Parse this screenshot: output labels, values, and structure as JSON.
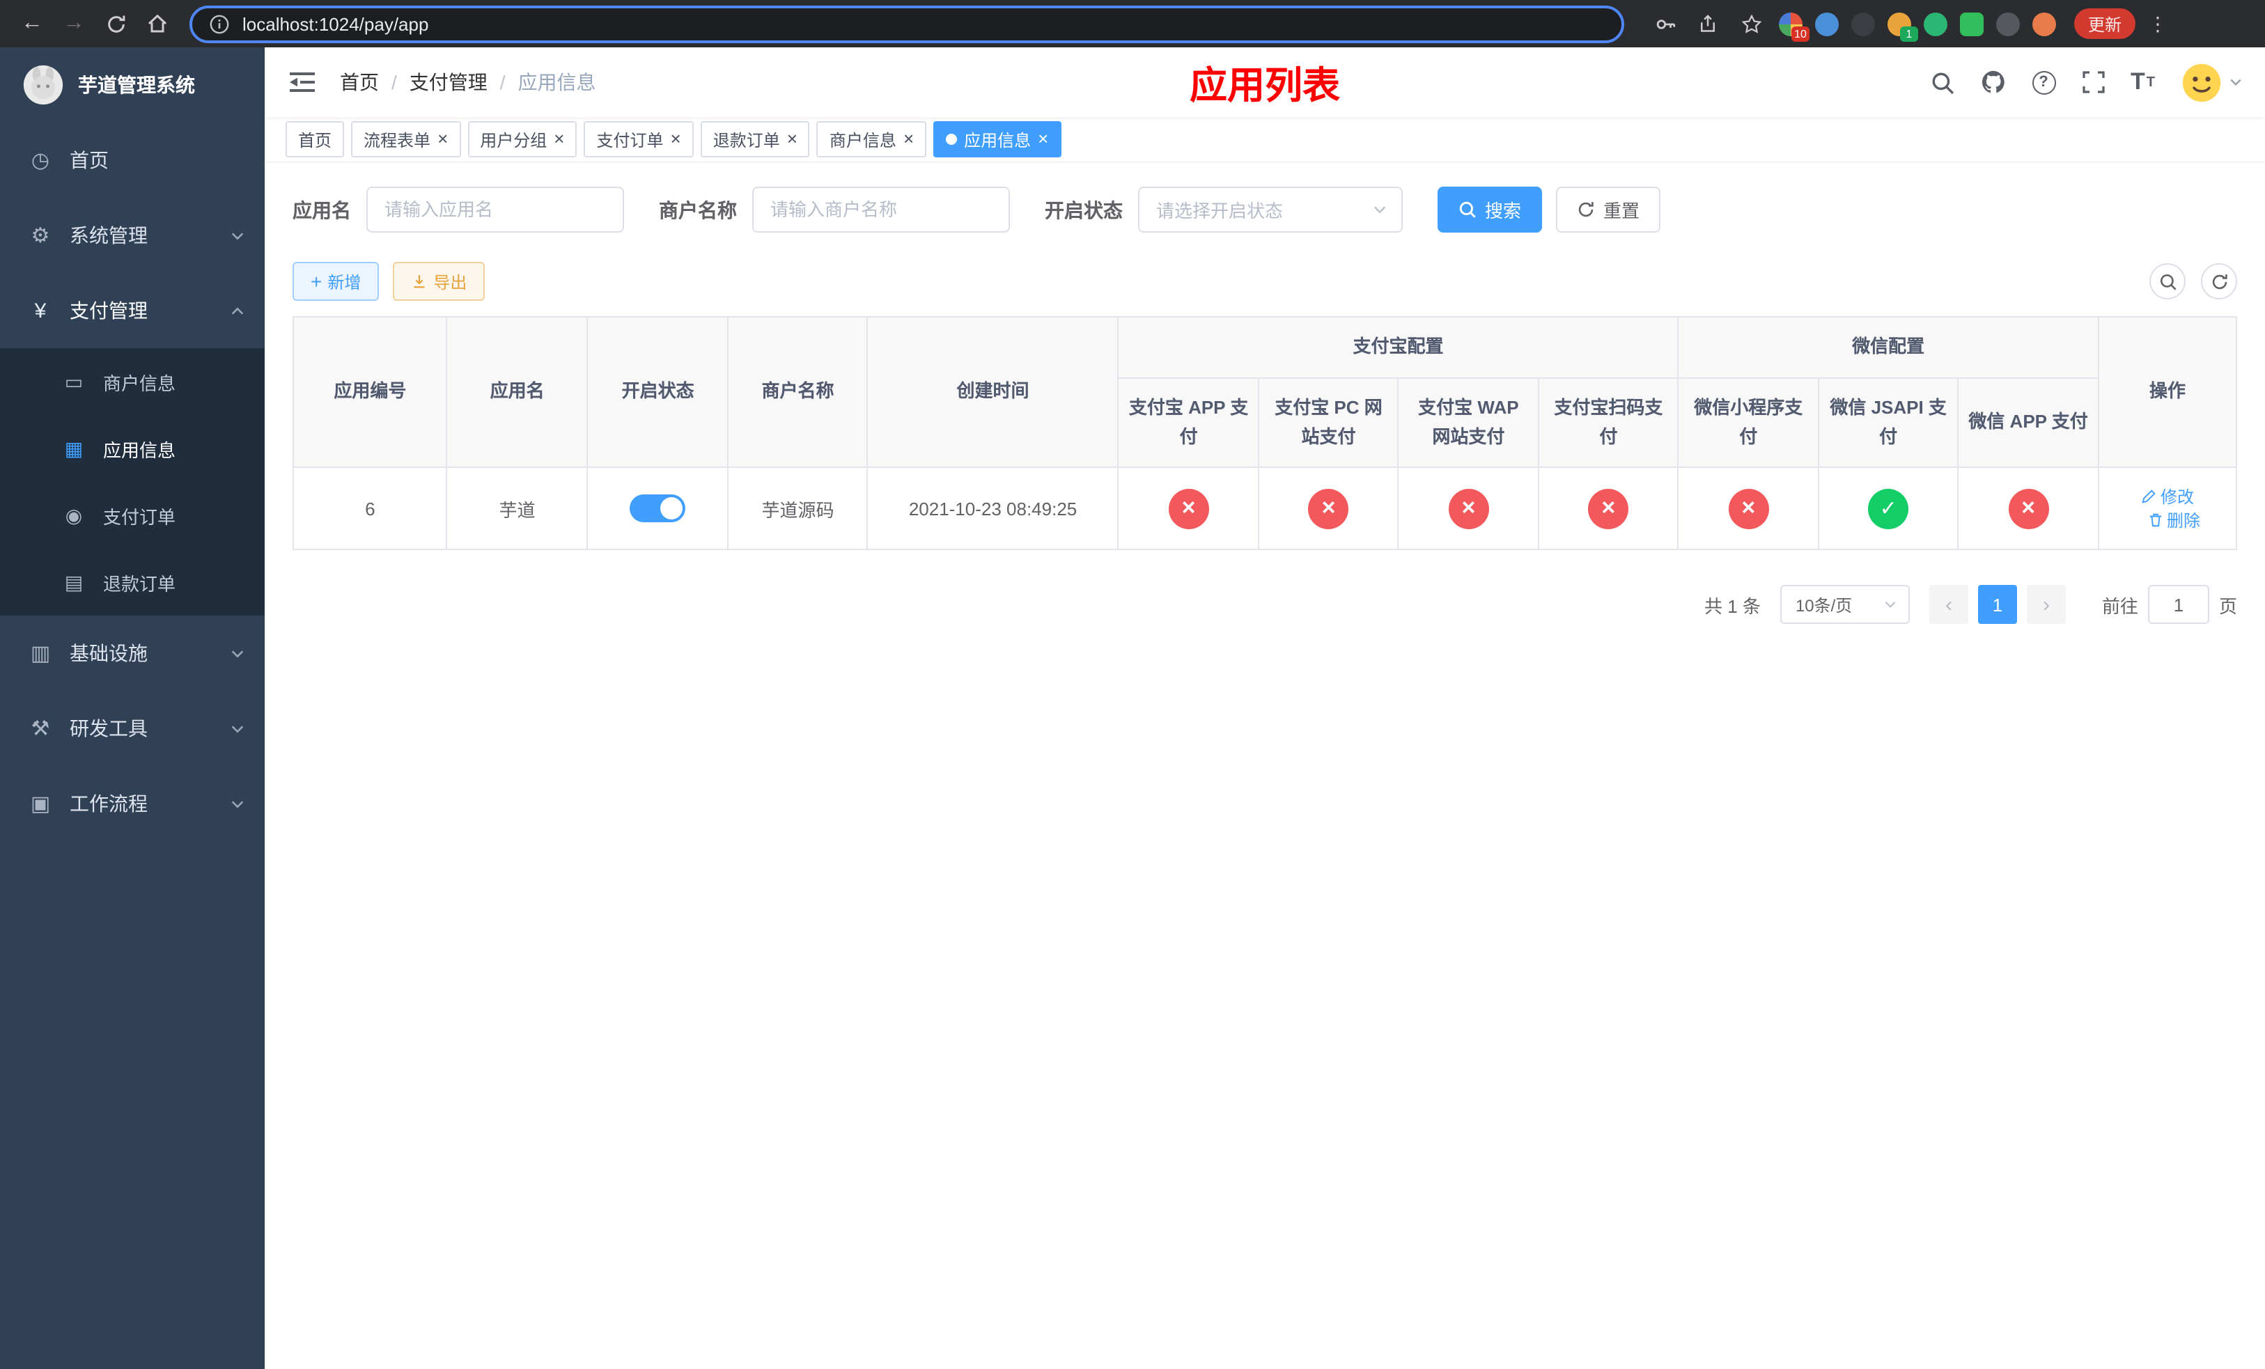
{
  "browser": {
    "url": "localhost:1024/pay/app",
    "update_label": "更新",
    "ext_badge_puzzle": "10",
    "ext_badge_avatar": "1"
  },
  "sidebar": {
    "app_title": "芋道管理系统",
    "menu": {
      "home": "首页",
      "system": "系统管理",
      "payment": "支付管理",
      "merchant_info": "商户信息",
      "app_info": "应用信息",
      "pay_order": "支付订单",
      "refund_order": "退款订单",
      "infrastructure": "基础设施",
      "dev_tools": "研发工具",
      "workflow": "工作流程"
    }
  },
  "topbar": {
    "breadcrumb": [
      "首页",
      "支付管理",
      "应用信息"
    ],
    "page_title": "应用列表"
  },
  "tabs": [
    {
      "label": "首页"
    },
    {
      "label": "流程表单"
    },
    {
      "label": "用户分组"
    },
    {
      "label": "支付订单"
    },
    {
      "label": "退款订单"
    },
    {
      "label": "商户信息"
    },
    {
      "label": "应用信息"
    }
  ],
  "filters": {
    "app_name_label": "应用名",
    "app_name_placeholder": "请输入应用名",
    "merchant_label": "商户名称",
    "merchant_placeholder": "请输入商户名称",
    "status_label": "开启状态",
    "status_placeholder": "请选择开启状态",
    "search_label": "搜索",
    "reset_label": "重置"
  },
  "toolbar": {
    "add_label": "新增",
    "export_label": "导出"
  },
  "table": {
    "headers": {
      "app_id": "应用编号",
      "app_name": "应用名",
      "status": "开启状态",
      "merchant_name": "商户名称",
      "create_time": "创建时间",
      "alipay_group": "支付宝配置",
      "wechat_group": "微信配置",
      "alipay_app": "支付宝 APP 支付",
      "alipay_pc": "支付宝 PC 网站支付",
      "alipay_wap": "支付宝 WAP 网站支付",
      "alipay_qr": "支付宝扫码支付",
      "wechat_mini": "微信小程序支付",
      "wechat_jsapi": "微信 JSAPI 支付",
      "wechat_app": "微信 APP 支付",
      "actions": "操作"
    },
    "rows": [
      {
        "app_id": "6",
        "app_name": "芋道",
        "status": "on",
        "merchant_name": "芋道源码",
        "create_time": "2021-10-23 08:49:25",
        "configs": [
          "fail",
          "fail",
          "fail",
          "fail",
          "fail",
          "success",
          "fail"
        ],
        "edit_label": "修改",
        "delete_label": "删除"
      }
    ]
  },
  "pagination": {
    "total_text": "共 1 条",
    "page_size": "10条/页",
    "current_page": "1",
    "goto_label": "前往",
    "goto_value": "1",
    "page_unit": "页"
  },
  "colors": {
    "primary": "#409eff",
    "success": "#13ce66",
    "danger": "#f3585c",
    "warning": "#e6a23c",
    "sidebar_bg": "#304156",
    "submenu_bg": "#1f2d3d",
    "title_red": "#ff0000"
  }
}
